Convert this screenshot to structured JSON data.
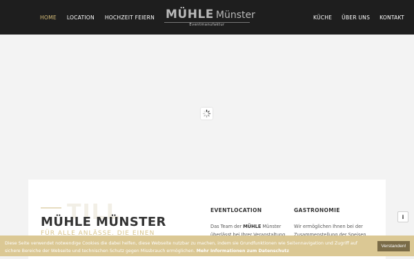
{
  "nav": {
    "left": [
      "HOME",
      "LOCATION",
      "HOCHZEIT FEIERN"
    ],
    "right": [
      "KÜCHE",
      "ÜBER UNS",
      "KONTAKT"
    ],
    "active_color": "#d8bf7a"
  },
  "logo": {
    "bold": "MÜHLE",
    "thin": "Münster",
    "sub": "Eventmanufaktur"
  },
  "loader": {
    "icon": "spinner-icon"
  },
  "card": {
    "ghost": "TILL",
    "title": "MÜHLE MÜNSTER",
    "subtitle": "FÜR ALLE ANLÄSSE. DIE EINEN",
    "columns": [
      {
        "title": "EVENTLOCATION",
        "text_pre": "Das Team der ",
        "text_bold": "MÜHLE",
        "text_post": " Münster überlässt bei Ihrer Veranstaltung"
      },
      {
        "title": "GASTRONOMIE",
        "text": "Wir ermöglichen Ihnen bei der Zusammenstellung der Speisen ein"
      }
    ]
  },
  "info_button": {
    "label": "i"
  },
  "cookie": {
    "text": "Diese Seite verwendet notwendige Cookies die dabei helfen, diese Webseite nutzbar zu machen, indem sie Grundfunktionen wie Seitennavigation und Zugriff auf sichere Bereiche der Webseite und technischen Schutz gegen Missbrauch ermöglichen. ",
    "link": "Mehr Informationen zum Datenschutz",
    "accept": "Verstanden!",
    "bar_color": "#d8c48c",
    "button_color": "#7a6b47"
  }
}
